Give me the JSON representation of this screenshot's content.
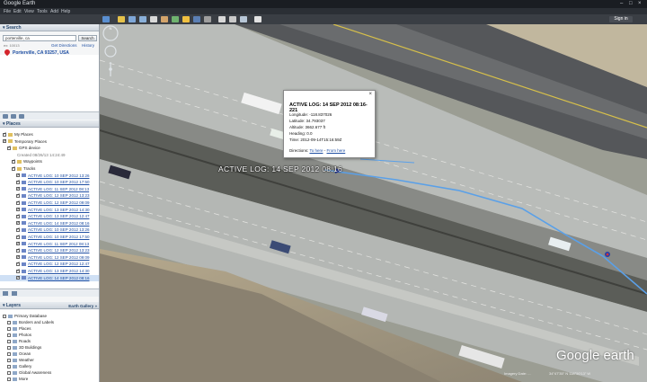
{
  "window": {
    "title": "Google Earth"
  },
  "menu": [
    "File",
    "Edit",
    "View",
    "Tools",
    "Add",
    "Help"
  ],
  "toolbar": {
    "signin_label": "Sign in"
  },
  "search": {
    "header": "Search",
    "value": "porterville, ca",
    "button_label": "Search",
    "hint": "ex: 10013",
    "get_directions": "Get Directions",
    "history": "History",
    "result": "Porterville, CA 93257, USA"
  },
  "places": {
    "header": "Places",
    "rows": [
      {
        "label": "My Places",
        "indent": 0,
        "checked": true,
        "link": false
      },
      {
        "label": "Temporary Places",
        "indent": 0,
        "checked": true,
        "link": false
      },
      {
        "label": "GPS device",
        "indent": 1,
        "checked": true,
        "link": false
      },
      {
        "label": "Created 08/26/13 14:24:49",
        "indent": 2,
        "checked": false,
        "link": false,
        "note": true
      },
      {
        "label": "Waypoints",
        "indent": 2,
        "checked": true,
        "link": false
      },
      {
        "label": "Tracks",
        "indent": 2,
        "checked": true,
        "link": false
      },
      {
        "label": "ACTIVE LOG: 10 SEP 2012 13:26",
        "indent": 3,
        "checked": true,
        "link": true
      },
      {
        "label": "ACTIVE LOG: 10 SEP 2012 17:50",
        "indent": 3,
        "checked": true,
        "link": true
      },
      {
        "label": "ACTIVE LOG: 11 SEP 2012 08:13",
        "indent": 3,
        "checked": true,
        "link": true
      },
      {
        "label": "ACTIVE LOG: 12 SEP 2012 13:23",
        "indent": 3,
        "checked": true,
        "link": true
      },
      {
        "label": "ACTIVE LOG: 12 SEP 2012 09:09",
        "indent": 3,
        "checked": true,
        "link": true
      },
      {
        "label": "ACTIVE LOG: 13 SEP 2012 14:30",
        "indent": 3,
        "checked": true,
        "link": true
      },
      {
        "label": "ACTIVE LOG: 13 SEP 2012 12:47",
        "indent": 3,
        "checked": true,
        "link": true
      },
      {
        "label": "ACTIVE LOG: 14 SEP 2012 08:16",
        "indent": 3,
        "checked": true,
        "link": true
      },
      {
        "label": "ACTIVE LOG: 10 SEP 2012 13:26",
        "indent": 3,
        "checked": true,
        "link": true
      },
      {
        "label": "ACTIVE LOG: 10 SEP 2012 17:50",
        "indent": 3,
        "checked": true,
        "link": true
      },
      {
        "label": "ACTIVE LOG: 11 SEP 2012 08:13",
        "indent": 3,
        "checked": true,
        "link": true
      },
      {
        "label": "ACTIVE LOG: 12 SEP 2012 13:23",
        "indent": 3,
        "checked": true,
        "link": true
      },
      {
        "label": "ACTIVE LOG: 12 SEP 2012 09:09",
        "indent": 3,
        "checked": true,
        "link": true
      },
      {
        "label": "ACTIVE LOG: 12 SEP 2012 12:47",
        "indent": 3,
        "checked": true,
        "link": true
      },
      {
        "label": "ACTIVE LOG: 13 SEP 2012 14:30",
        "indent": 3,
        "checked": true,
        "link": true
      },
      {
        "label": "ACTIVE LOG: 14 SEP 2012 08:16",
        "indent": 3,
        "checked": true,
        "link": true,
        "selected": true
      }
    ]
  },
  "layers": {
    "header": "Layers",
    "gallery": "Earth Gallery »",
    "rows": [
      {
        "label": "Primary Database",
        "indent": 0
      },
      {
        "label": "Borders and Labels",
        "indent": 1
      },
      {
        "label": "Places",
        "indent": 1
      },
      {
        "label": "Photos",
        "indent": 1
      },
      {
        "label": "Roads",
        "indent": 1
      },
      {
        "label": "3D Buildings",
        "indent": 1
      },
      {
        "label": "Ocean",
        "indent": 1
      },
      {
        "label": "Weather",
        "indent": 1
      },
      {
        "label": "Gallery",
        "indent": 1
      },
      {
        "label": "Global Awareness",
        "indent": 1
      },
      {
        "label": "More",
        "indent": 1
      }
    ]
  },
  "popup": {
    "title": "ACTIVE LOG: 14 SEP 2012 08:16-221",
    "close": "×",
    "lines": [
      "Longitude: -118.837026",
      "Latitude: 34.793037",
      "Altitude: 3662.677 ft",
      "Heading: 0.0",
      "Time: 2012-09-14T15:16:59Z"
    ],
    "directions_label": "Directions:",
    "to_here": "To here",
    "separator": "-",
    "from_here": "From here"
  },
  "map": {
    "track_label": "ACTIVE LOG: 14 SEP 2012 08:16",
    "logo": "Google earth",
    "imagery_date": "Imagery Date: ...",
    "coords": "34°47'35\" N 118°50'13\" W"
  },
  "colors": {
    "track": "#5aa0e8",
    "link": "#1f4fa3",
    "panel_header": "#2b4a6f"
  }
}
